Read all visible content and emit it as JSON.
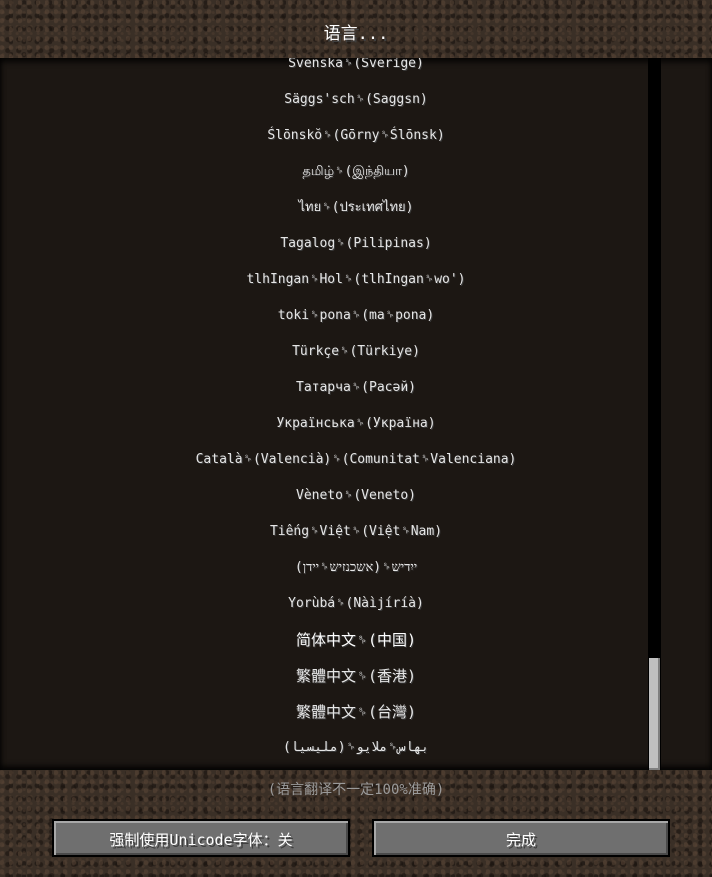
{
  "header": {
    "title": "语言..."
  },
  "languages": [
    "Svenska␠(Sverige)",
    "Säggs'sch␠(Saggsn)",
    "Ślōnskŏ␠(Gōrny␠Ślōnsk)",
    "தமிழ்␠(இந்தியா)",
    "ไทย␠(ประเทศไทย)",
    "Tagalog␠(Pilipinas)",
    "tlhIngan␠Hol␠(tlhIngan␠wo')",
    "toki␠pona␠(ma␠pona)",
    "Türkçe␠(Türkiye)",
    "Татарча␠(Расәй)",
    "Українська␠(Україна)",
    "Català␠(Valencià)␠(Comunitat␠Valenciana)",
    "Vèneto␠(Veneto)",
    "Tiếng␠Việt␠(Việt␠Nam)",
    "ייִדיש␠(אשכנזיש␠יידן)",
    "Yorùbá␠(Nàìjíríà)",
    "简体中文␠(中国)",
    "繁體中文␠(香港)",
    "繁體中文␠(台灣)",
    "بهاس␠ملايو␠(مليسيا)"
  ],
  "selected_language": "简体中文␠(中国)",
  "footer": {
    "note": "(语言翻译不一定100%准确)",
    "unicode_button_label": "强制使用Unicode字体：关",
    "done_button_label": "完成"
  },
  "colors": {
    "background_dirt": "#3a2f26",
    "list_background": "#1c1713",
    "selection_border": "#8a8a8a",
    "button_fill": "#6f6f6f",
    "scroll_thumb": "#c0c0c0"
  }
}
